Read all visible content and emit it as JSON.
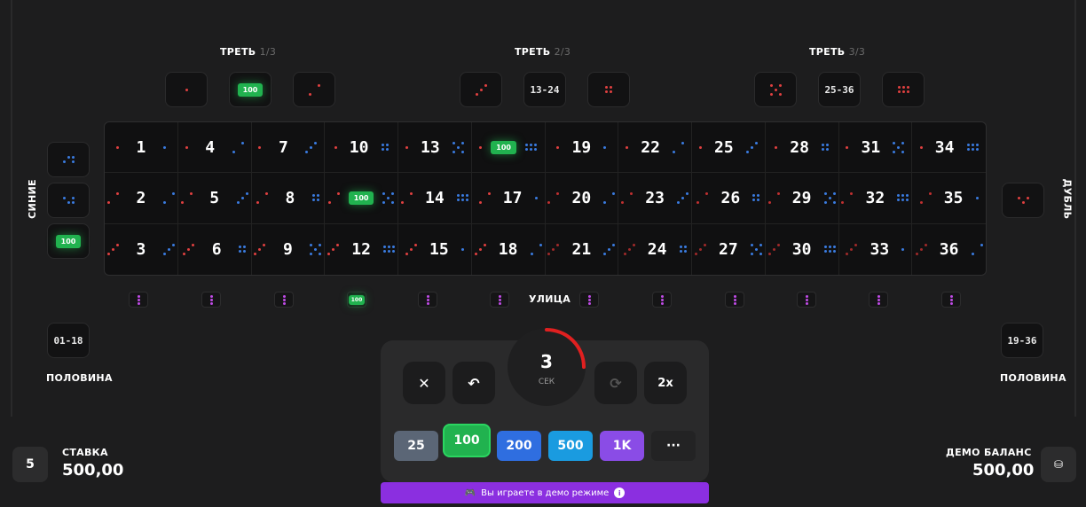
{
  "thirds": [
    {
      "label": "ТРЕТЬ",
      "fraction": "1/3",
      "tiles": [
        {
          "kind": "dots",
          "pattern": "one",
          "color": "#e04040"
        },
        {
          "kind": "chip",
          "value": "100"
        },
        {
          "kind": "dots",
          "pattern": "diag2",
          "color": "#e04040"
        }
      ]
    },
    {
      "label": "ТРЕТЬ",
      "fraction": "2/3",
      "tiles": [
        {
          "kind": "dots",
          "pattern": "diag3",
          "color": "#e04040"
        },
        {
          "kind": "text",
          "value": "13-24"
        },
        {
          "kind": "dots",
          "pattern": "four",
          "color": "#e04040"
        }
      ]
    },
    {
      "label": "ТРЕТЬ",
      "fraction": "3/3",
      "tiles": [
        {
          "kind": "dots",
          "pattern": "five",
          "color": "#e04040"
        },
        {
          "kind": "text",
          "value": "25-36"
        },
        {
          "kind": "dots",
          "pattern": "six",
          "color": "#e04040"
        }
      ]
    }
  ],
  "left_side": {
    "label": "СИНИЕ",
    "chip": "100"
  },
  "right_side": {
    "label": "ДУБЛЬ"
  },
  "board": {
    "rows": [
      [
        "1",
        "4",
        "7",
        "10",
        "13",
        "",
        "19",
        "22",
        "25",
        "28",
        "31",
        "34"
      ],
      [
        "2",
        "5",
        "8",
        "",
        "14",
        "17",
        "20",
        "23",
        "26",
        "29",
        "32",
        "35"
      ],
      [
        "3",
        "6",
        "9",
        "12",
        "15",
        "18",
        "21",
        "24",
        "27",
        "30",
        "33",
        "36"
      ]
    ],
    "chips": [
      {
        "row": 0,
        "col": 5,
        "value": "100"
      },
      {
        "row": 1,
        "col": 3,
        "value": "100"
      }
    ]
  },
  "street": {
    "label": "УЛИЦА",
    "chip": "100"
  },
  "halves": {
    "left": "01-18",
    "right": "19-36",
    "label": "ПОЛОВИНА"
  },
  "timer": {
    "value": "3",
    "unit": "СЕК",
    "progress": 0.25
  },
  "controls": {
    "clear": "✕",
    "undo": "↶",
    "repeat": "⟳",
    "double": "2x"
  },
  "chips": [
    {
      "value": "25",
      "color": "#5b6676"
    },
    {
      "value": "100",
      "color": "#21b24f",
      "selected": true
    },
    {
      "value": "200",
      "color": "#2f6ee0"
    },
    {
      "value": "500",
      "color": "#1a9be0"
    },
    {
      "value": "1K",
      "color": "#8a4ce6"
    },
    {
      "value": "···",
      "color": "#232324"
    }
  ],
  "bet": {
    "icon_value": "5",
    "label": "СТАВКА",
    "amount": "500,00"
  },
  "balance": {
    "label": "ДЕМО БАЛАНС",
    "amount": "500,00"
  },
  "demo_notice": "Вы играете в демо режиме",
  "colors": {
    "red": "#e04040",
    "blue": "#3a7be0",
    "green": "#21b24f",
    "purple": "#c04be6"
  }
}
